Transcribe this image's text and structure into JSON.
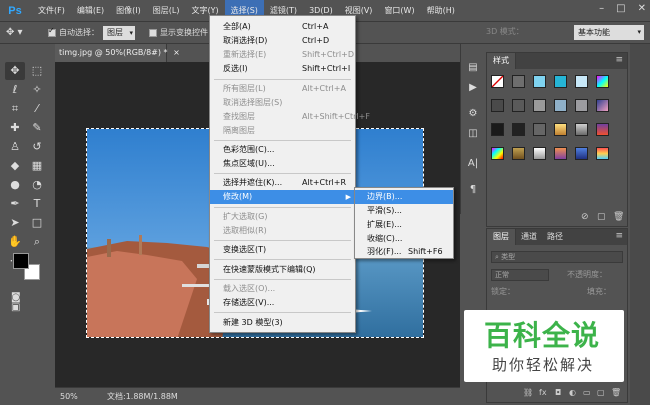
{
  "menubar": {
    "logo": "Ps",
    "items": [
      "文件(F)",
      "编辑(E)",
      "图像(I)",
      "图层(L)",
      "文字(Y)",
      "选择(S)",
      "滤镜(T)",
      "3D(D)",
      "视图(V)",
      "窗口(W)",
      "帮助(H)"
    ],
    "active_index": 5,
    "window_buttons": [
      "–",
      "□",
      "✕"
    ]
  },
  "options": {
    "auto_select_label": "自动选择：",
    "auto_select_value": "图层",
    "show_transform_label": "显示变换控件",
    "mode_3d_label": "3D 模式：",
    "workspace": "基本功能"
  },
  "document": {
    "tab_title": "timg.jpg @ 50%(RGB/8#) *",
    "zoom": "50%",
    "doc_info": "文档:1.88M/1.88M"
  },
  "select_menu": [
    {
      "label": "全部(A)",
      "shortcut": "Ctrl+A",
      "disabled": false
    },
    {
      "label": "取消选择(D)",
      "shortcut": "Ctrl+D",
      "disabled": false
    },
    {
      "label": "重新选择(E)",
      "shortcut": "Shift+Ctrl+D",
      "disabled": true
    },
    {
      "label": "反选(I)",
      "shortcut": "Shift+Ctrl+I",
      "disabled": false
    },
    {
      "label": "所有图层(L)",
      "shortcut": "Alt+Ctrl+A",
      "disabled": true
    },
    {
      "label": "取消选择图层(S)",
      "shortcut": "",
      "disabled": true
    },
    {
      "label": "查找图层",
      "shortcut": "Alt+Shift+Ctrl+F",
      "disabled": true
    },
    {
      "label": "隔离图层",
      "shortcut": "",
      "disabled": true
    },
    {
      "label": "色彩范围(C)...",
      "shortcut": "",
      "disabled": false
    },
    {
      "label": "焦点区域(U)...",
      "shortcut": "",
      "disabled": false
    },
    {
      "label": "选择并遮住(K)...",
      "shortcut": "Alt+Ctrl+R",
      "disabled": false
    },
    {
      "label": "修改(M)",
      "shortcut": "",
      "disabled": false
    },
    {
      "label": "扩大选取(G)",
      "shortcut": "",
      "disabled": true
    },
    {
      "label": "选取相似(R)",
      "shortcut": "",
      "disabled": true
    },
    {
      "label": "变换选区(T)",
      "shortcut": "",
      "disabled": false
    },
    {
      "label": "在快速蒙版模式下编辑(Q)",
      "shortcut": "",
      "disabled": false
    },
    {
      "label": "载入选区(O)...",
      "shortcut": "",
      "disabled": true
    },
    {
      "label": "存储选区(V)...",
      "shortcut": "",
      "disabled": false
    },
    {
      "label": "新建 3D 模型(3)",
      "shortcut": "",
      "disabled": false
    }
  ],
  "modify_submenu": [
    {
      "label": "边界(B)...",
      "shortcut": ""
    },
    {
      "label": "平滑(S)...",
      "shortcut": ""
    },
    {
      "label": "扩展(E)...",
      "shortcut": ""
    },
    {
      "label": "收缩(C)...",
      "shortcut": ""
    },
    {
      "label": "羽化(F)...",
      "shortcut": "Shift+F6"
    }
  ],
  "styles_panel": {
    "tab": "样式"
  },
  "layers_panel": {
    "tabs": [
      "图层",
      "通道",
      "路径"
    ],
    "kind_label": "类型",
    "blend_mode": "正常",
    "opacity_label": "不透明度：",
    "lock_label": "锁定：",
    "fill_label": "填充："
  },
  "watermark": {
    "title": "百科全说",
    "subtitle": "助你轻松解决"
  },
  "colors": {
    "ui_bg": "#535353",
    "menu_highlight": "#3d8ee6",
    "watermark_green": "#3cb34a"
  }
}
